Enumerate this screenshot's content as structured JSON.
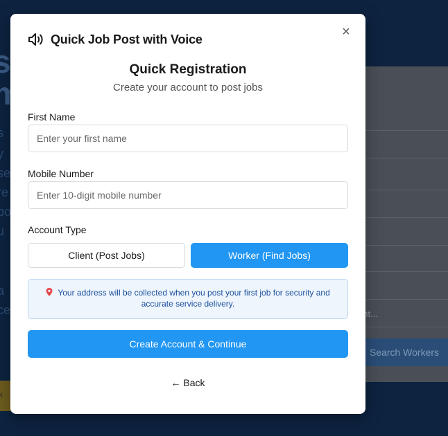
{
  "background": {
    "hero_fragments": [
      "st",
      "m"
    ],
    "side_fragments": [
      "s",
      "y",
      "se",
      "re",
      "bo",
      "u",
      "a",
      "ce"
    ],
    "panel_text": "ent...",
    "search_button": "Search Workers",
    "bottom_fragment": "rk"
  },
  "modal": {
    "title": "Quick Job Post with Voice",
    "close_label": "×",
    "heading": "Quick Registration",
    "subheading": "Create your account to post jobs",
    "first_name": {
      "label": "First Name",
      "placeholder": "Enter your first name",
      "value": ""
    },
    "mobile": {
      "label": "Mobile Number",
      "placeholder": "Enter 10-digit mobile number",
      "value": ""
    },
    "account_type": {
      "label": "Account Type",
      "options": [
        "Client (Post Jobs)",
        "Worker (Find Jobs)"
      ],
      "selected": "Worker (Find Jobs)"
    },
    "info_text": "Your address will be collected when you post your first job for security and accurate service delivery.",
    "submit_label": "Create Account & Continue",
    "back_label": "← Back"
  },
  "colors": {
    "accent": "#2196f3",
    "info_bg": "#eef5fd",
    "info_text": "#1b4f9c",
    "backdrop": "#0d2340"
  },
  "icons": [
    "speaker-icon",
    "close-icon",
    "map-pin-icon",
    "arrow-left-icon"
  ]
}
